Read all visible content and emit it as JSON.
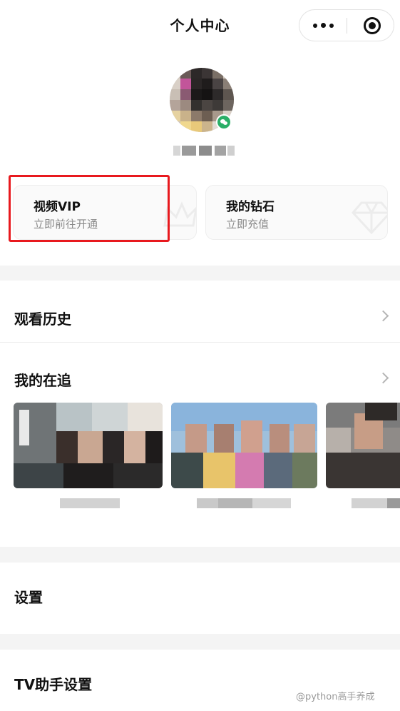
{
  "nav": {
    "title": "个人中心",
    "more_icon": "more-dots-icon",
    "close_icon": "target-circle-icon"
  },
  "profile": {
    "badge_icon": "wechat-icon"
  },
  "cards": {
    "vip": {
      "title": "视频VIP",
      "subtitle": "立即前往开通",
      "icon": "crown-icon"
    },
    "diamond": {
      "title": "我的钻石",
      "subtitle": "立即充值",
      "icon": "diamond-icon"
    }
  },
  "menu": {
    "history": "观看历史",
    "following": "我的在追",
    "settings": "设置",
    "tv_assistant": "TV助手设置"
  },
  "watermark": "@python高手养成",
  "colors": {
    "highlight": "#e8191e",
    "section_gap": "#f4f4f4",
    "badge": "#2aae67"
  }
}
